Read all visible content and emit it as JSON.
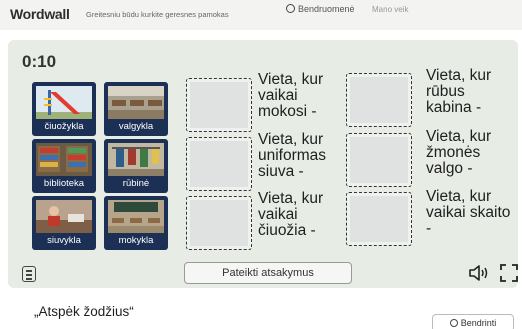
{
  "header": {
    "logo": "Wordwall",
    "tagline": "Greitesniu būdu kurkite geresnes pamokas",
    "search_label": "Bendruomenė",
    "ghost_text": "Mano veik"
  },
  "game": {
    "timer": "0:10",
    "tiles": [
      {
        "label": "čiuožykla"
      },
      {
        "label": "valgykla"
      },
      {
        "label": "biblioteka"
      },
      {
        "label": "rūbinė"
      },
      {
        "label": "siuvykla"
      },
      {
        "label": "mokykla"
      }
    ],
    "clues": [
      "Vieta, kur vaikai mokosi -",
      "Vieta, kur rūbus kabina -",
      "Vieta, kur uniformas siuva -",
      "Vieta, kur žmonės valgo -",
      "Vieta, kur vaikai čiuožia -",
      "Vieta, kur vaikai skaito -"
    ],
    "submit_label": "Pateikti atsakymus"
  },
  "footer": {
    "activity_title": "„Atspėk žodžius“",
    "share_label": "Bendrinti"
  },
  "colors": {
    "tile_bg": "#1c2f55",
    "stage_bg": "#e7ece4"
  }
}
